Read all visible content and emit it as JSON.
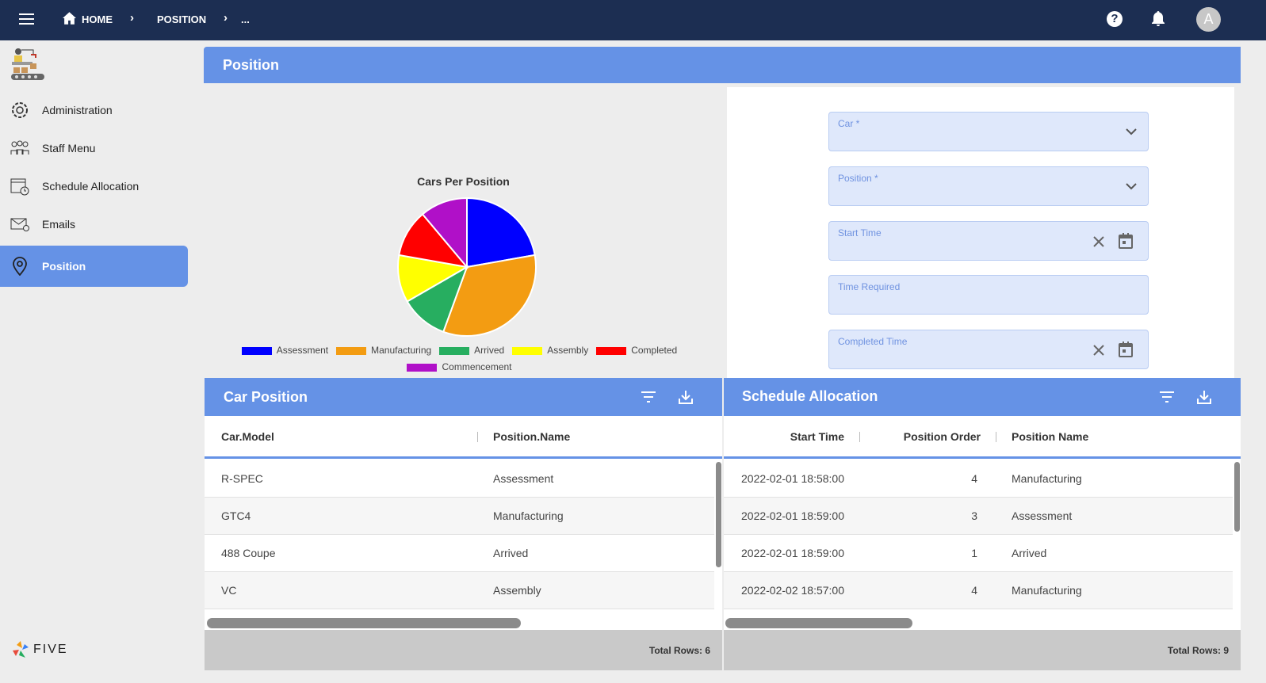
{
  "topbar": {
    "breadcrumb": [
      "HOME",
      "POSITION",
      "..."
    ],
    "avatar": "A",
    "icons": [
      "menu-icon",
      "home-icon",
      "help-icon",
      "bell-icon"
    ]
  },
  "sidebar": {
    "items": [
      {
        "label": "Administration",
        "icon": "gear-icon"
      },
      {
        "label": "Staff Menu",
        "icon": "staff-icon"
      },
      {
        "label": "Schedule Allocation",
        "icon": "calendar-clock-icon"
      },
      {
        "label": "Emails",
        "icon": "email-icon"
      },
      {
        "label": "Position",
        "icon": "location-pin-icon",
        "active": true
      }
    ],
    "brand": "FIVE"
  },
  "page": {
    "title": "Position"
  },
  "chart_data": {
    "type": "pie",
    "title": "Cars Per Position",
    "legend_placement": "bottom",
    "slices": [
      {
        "label": "Assessment",
        "value": 2,
        "color": "#0000ff"
      },
      {
        "label": "Manufacturing",
        "value": 3,
        "color": "#f39c12"
      },
      {
        "label": "Arrived",
        "value": 1,
        "color": "#27ae60"
      },
      {
        "label": "Assembly",
        "value": 1,
        "color": "#ffff00"
      },
      {
        "label": "Completed",
        "value": 1,
        "color": "#ff0000"
      },
      {
        "label": "Commencement",
        "value": 1,
        "color": "#b010c8"
      }
    ]
  },
  "form": {
    "fields": [
      {
        "label": "Car *",
        "type": "select"
      },
      {
        "label": "Position *",
        "type": "select"
      },
      {
        "label": "Start Time",
        "type": "datetime"
      },
      {
        "label": "Time Required",
        "type": "text"
      },
      {
        "label": "Completed Time",
        "type": "datetime"
      }
    ]
  },
  "car_position": {
    "title": "Car Position",
    "columns": [
      "Car.Model",
      "Position.Name"
    ],
    "rows": [
      [
        "R-SPEC",
        "Assessment"
      ],
      [
        "GTC4",
        "Manufacturing"
      ],
      [
        "488 Coupe",
        "Arrived"
      ],
      [
        "VC",
        "Assembly"
      ]
    ],
    "total": "Total Rows: 6"
  },
  "schedule": {
    "title": "Schedule Allocation",
    "columns": [
      "Start Time",
      "Position Order",
      "Position Name"
    ],
    "rows": [
      [
        "2022-02-01 18:58:00",
        "4",
        "Manufacturing"
      ],
      [
        "2022-02-01 18:59:00",
        "3",
        "Assessment"
      ],
      [
        "2022-02-01 18:59:00",
        "1",
        "Arrived"
      ],
      [
        "2022-02-02 18:57:00",
        "4",
        "Manufacturing"
      ]
    ],
    "total": "Total Rows: 9"
  },
  "colors": {
    "topbar": "#1c2e52",
    "accent": "#6592e6"
  }
}
